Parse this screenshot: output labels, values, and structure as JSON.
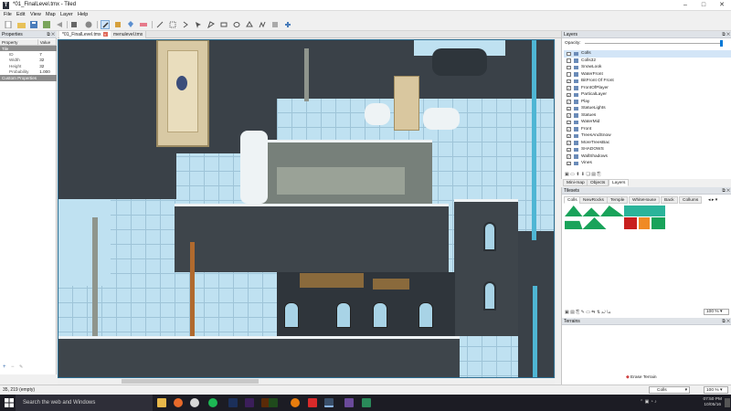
{
  "window": {
    "title": "*01_FinalLevel.tmx - Tiled",
    "minimize": "–",
    "maximize": "□",
    "close": "✕"
  },
  "menu": [
    "File",
    "Edit",
    "View",
    "Map",
    "Layer",
    "Help"
  ],
  "toolbar": {
    "icons": [
      "new-icon",
      "open-icon",
      "save-icon",
      "save-all-icon",
      "undo-icon",
      "redo-icon",
      "command-icon",
      "random-mode-icon",
      "stamp-brush-icon",
      "terrain-brush-icon",
      "bucket-fill-icon",
      "eraser-icon",
      "rect-select-icon",
      "magic-wand-icon",
      "select-same-tile-icon",
      "select-objects-icon",
      "edit-polygons-icon",
      "insert-rect-icon",
      "insert-ellipse-icon",
      "insert-polygon-icon",
      "insert-polyline-icon",
      "insert-tile-icon",
      "text-icon"
    ]
  },
  "properties": {
    "header": "Properties",
    "columns": [
      "Property",
      "Value"
    ],
    "section_tile": "Tile",
    "rows": [
      {
        "key": "ID",
        "value": "7"
      },
      {
        "key": "Width",
        "value": "32"
      },
      {
        "key": "Height",
        "value": "32"
      },
      {
        "key": "Probability",
        "value": "1.000"
      }
    ],
    "section_custom": "Custom Properties"
  },
  "tabs": [
    {
      "label": "*01_FinalLevel.tmx",
      "close": "x"
    },
    {
      "label": "menulevel.tmx"
    }
  ],
  "layers": {
    "header": "Layers",
    "opacity_label": "Opacity:",
    "opacity": 1.0,
    "items": [
      {
        "name": "Colls",
        "checked": false,
        "selected": true
      },
      {
        "name": "Colls32",
        "checked": false
      },
      {
        "name": "SnowLook",
        "checked": false
      },
      {
        "name": "WaterFront",
        "checked": false
      },
      {
        "name": "BitFront Of Front",
        "checked": true
      },
      {
        "name": "FrontOfPlayer",
        "checked": true
      },
      {
        "name": "ParticalLayer",
        "checked": true
      },
      {
        "name": "Play",
        "checked": true
      },
      {
        "name": "StatueLights",
        "checked": true
      },
      {
        "name": "Statues",
        "checked": true
      },
      {
        "name": "WaterMid",
        "checked": true
      },
      {
        "name": "Front",
        "checked": true
      },
      {
        "name": "TreesAndSnow",
        "checked": true
      },
      {
        "name": "MoreTreesBac",
        "checked": true
      },
      {
        "name": "SHADOWS",
        "checked": true
      },
      {
        "name": "WallShadows",
        "checked": true
      },
      {
        "name": "Vines",
        "checked": true
      }
    ],
    "bottom_tabs": [
      "Mini-map",
      "Objects",
      "Layers"
    ]
  },
  "tilesets": {
    "header": "Tilesets",
    "tabs": [
      "Colls",
      "NewRocks",
      "Temple",
      "WhiteHouse",
      "Back",
      "Collums"
    ],
    "zoom": "100 %"
  },
  "terrains": {
    "header": "Terrains",
    "erase_label": "Erase Terrain"
  },
  "status": {
    "coords": "35, 219 (empty)",
    "layer": "Colls",
    "zoom": "100 %"
  },
  "taskbar": {
    "search_placeholder": "Search the web and Windows",
    "time": "07:50 PM",
    "date": "10/05/16",
    "apps": [
      "file-explorer-icon",
      "firefox-icon",
      "chrome-icon",
      "spotify-icon",
      "photoshop-icon",
      "premiere-icon",
      "illustrator-icon",
      "dreamweaver-icon",
      "blender-icon",
      "app-red-icon",
      "tiled-icon",
      "visual-studio-icon",
      "app-green-icon"
    ]
  },
  "colors": {
    "accent": "#0078d7",
    "grid": "#9ec4d8",
    "sky": "#bfe1f1",
    "stone": "#3e454b",
    "snow": "#eef3f5"
  }
}
